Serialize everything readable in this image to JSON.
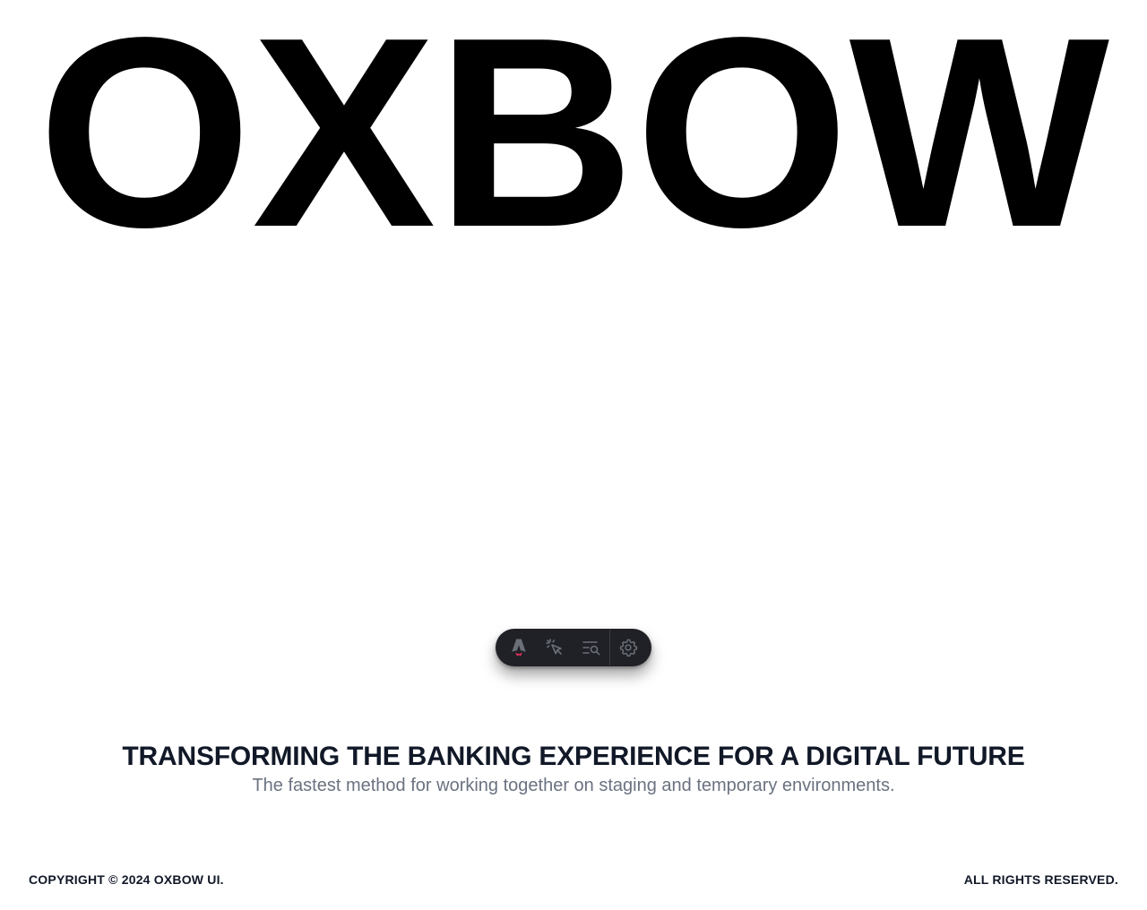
{
  "logo": {
    "text": "OXBOW"
  },
  "toolbar": {
    "buttons": [
      {
        "icon": "astro-logo-icon",
        "tooltip": ""
      },
      {
        "icon": "cursor-select-icon",
        "tooltip": ""
      },
      {
        "icon": "search-list-icon",
        "tooltip": ""
      },
      {
        "icon": "gear-icon",
        "tooltip": ""
      }
    ],
    "background": "#1f2126",
    "icon_color": "#6b6f78",
    "accent": "#e0315b"
  },
  "hero": {
    "title": "TRANSFORMING THE BANKING EXPERIENCE FOR A DIGITAL FUTURE",
    "subtitle": "The fastest method for working together on staging and temporary environments."
  },
  "footer": {
    "copyright": "COPYRIGHT © 2024 OXBOW UI.",
    "rights": "ALL RIGHTS RESERVED."
  },
  "colors": {
    "text": "#111827",
    "muted": "#6b7280",
    "logo": "#000000"
  }
}
